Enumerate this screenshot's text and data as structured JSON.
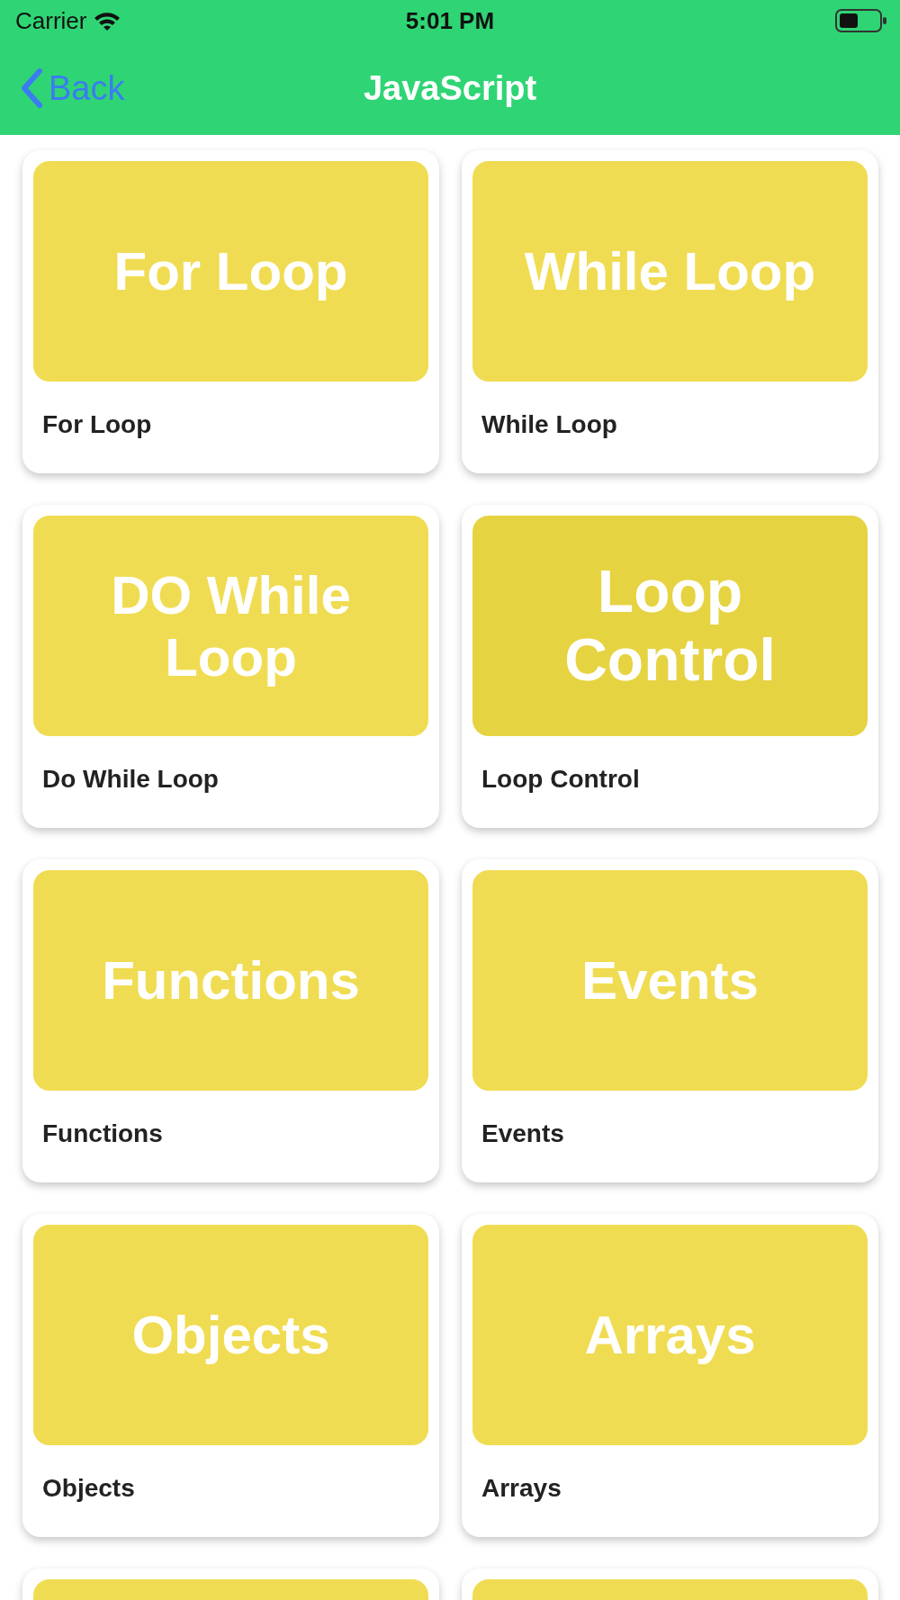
{
  "status_bar": {
    "carrier": "Carrier",
    "time": "5:01 PM"
  },
  "nav": {
    "back": "Back",
    "title": "JavaScript"
  },
  "cards": [
    {
      "kind": "full",
      "tile": "For Loop",
      "caption": "For Loop",
      "selected": false
    },
    {
      "kind": "full",
      "tile": "While Loop",
      "caption": "While Loop",
      "selected": false
    },
    {
      "kind": "full",
      "tile": "DO While Loop",
      "caption": "Do While Loop",
      "selected": false
    },
    {
      "kind": "full",
      "tile": "Loop Control",
      "caption": "Loop Control",
      "selected": true
    },
    {
      "kind": "full",
      "tile": "Functions",
      "caption": "Functions",
      "selected": false
    },
    {
      "kind": "full",
      "tile": "Events",
      "caption": "Events",
      "selected": false
    },
    {
      "kind": "full",
      "tile": "Objects",
      "caption": "Objects",
      "selected": false
    },
    {
      "kind": "full",
      "tile": "Arrays",
      "caption": "Arrays",
      "selected": false
    },
    {
      "kind": "partial",
      "selected": false
    },
    {
      "kind": "partial",
      "selected": false
    }
  ]
}
